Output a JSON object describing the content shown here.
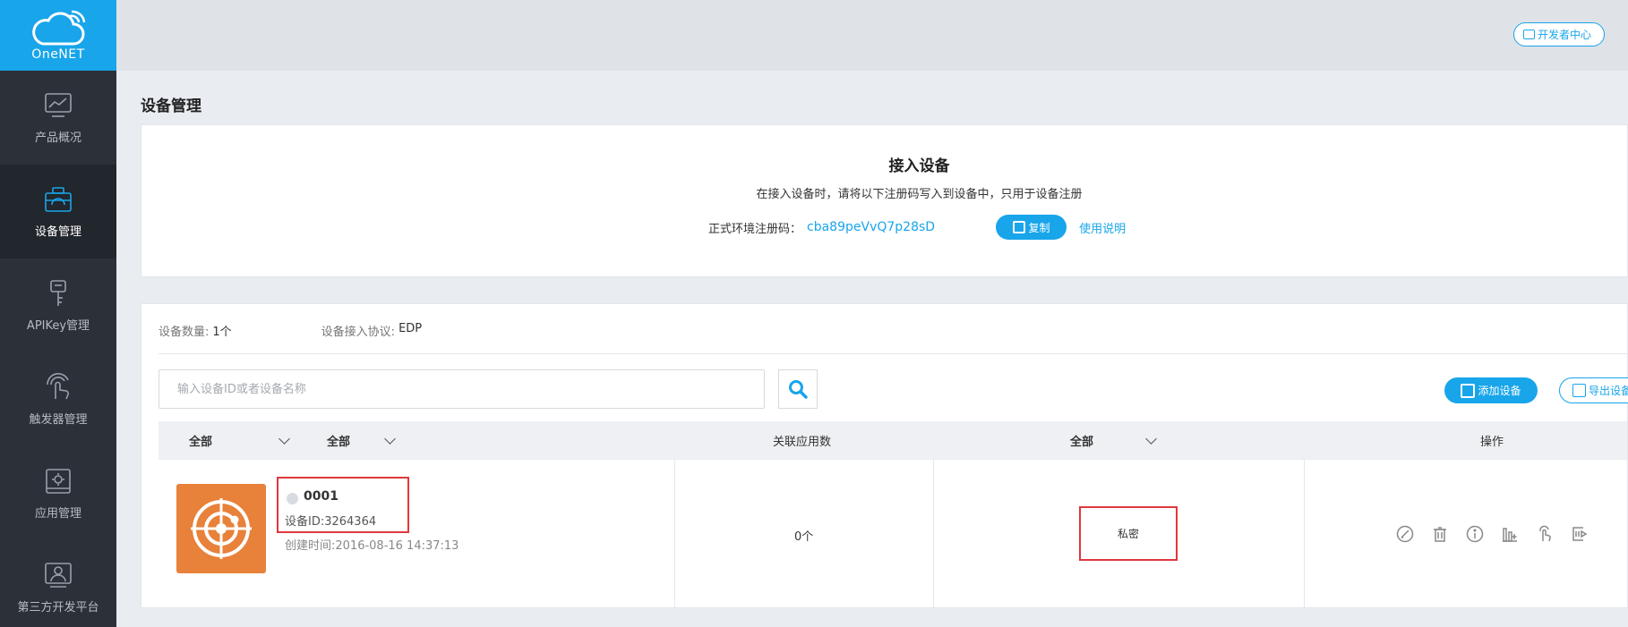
{
  "brand": {
    "name": "OneNET",
    "color": "#18a5ea"
  },
  "sidebar": {
    "items": [
      {
        "label": "产品概况",
        "icon": "chart-screen-icon",
        "active": false
      },
      {
        "label": "设备管理",
        "icon": "toolbox-icon",
        "active": true
      },
      {
        "label": "APIKey管理",
        "icon": "key-icon",
        "active": false
      },
      {
        "label": "触发器管理",
        "icon": "touch-hand-icon",
        "active": false
      },
      {
        "label": "应用管理",
        "icon": "gear-box-icon",
        "active": false
      },
      {
        "label": "第三方开发平台",
        "icon": "user-frame-icon",
        "active": false
      }
    ]
  },
  "topbar": {
    "dev_center_label": "开发者中心"
  },
  "page": {
    "title": "设备管理"
  },
  "access": {
    "title": "接入设备",
    "subtitle": "在接入设备时，请将以下注册码写入到设备中，只用于设备注册",
    "code_label": "正式环境注册码：",
    "code_value": "cba89peVvQ7p28sD",
    "copy_label": "复制",
    "usage_label": "使用说明"
  },
  "devices": {
    "count_label": "设备数量:",
    "count_value": "1个",
    "protocol_label": "设备接入协议:",
    "protocol_value": "EDP",
    "search_placeholder": "输入设备ID或者设备名称",
    "add_label": "添加设备",
    "export_label": "导出设备",
    "columns": {
      "filter1": "全部",
      "filter2": "全部",
      "apps": "关联应用数",
      "filter3": "全部",
      "ops": "操作"
    },
    "rows": [
      {
        "name": "0001",
        "id_text": "设备ID:3264364",
        "created_text": "创建时间:2016-08-16 14:37:13",
        "app_count": "0个",
        "privacy": "私密",
        "thumb_color": "#e8813a"
      }
    ]
  }
}
